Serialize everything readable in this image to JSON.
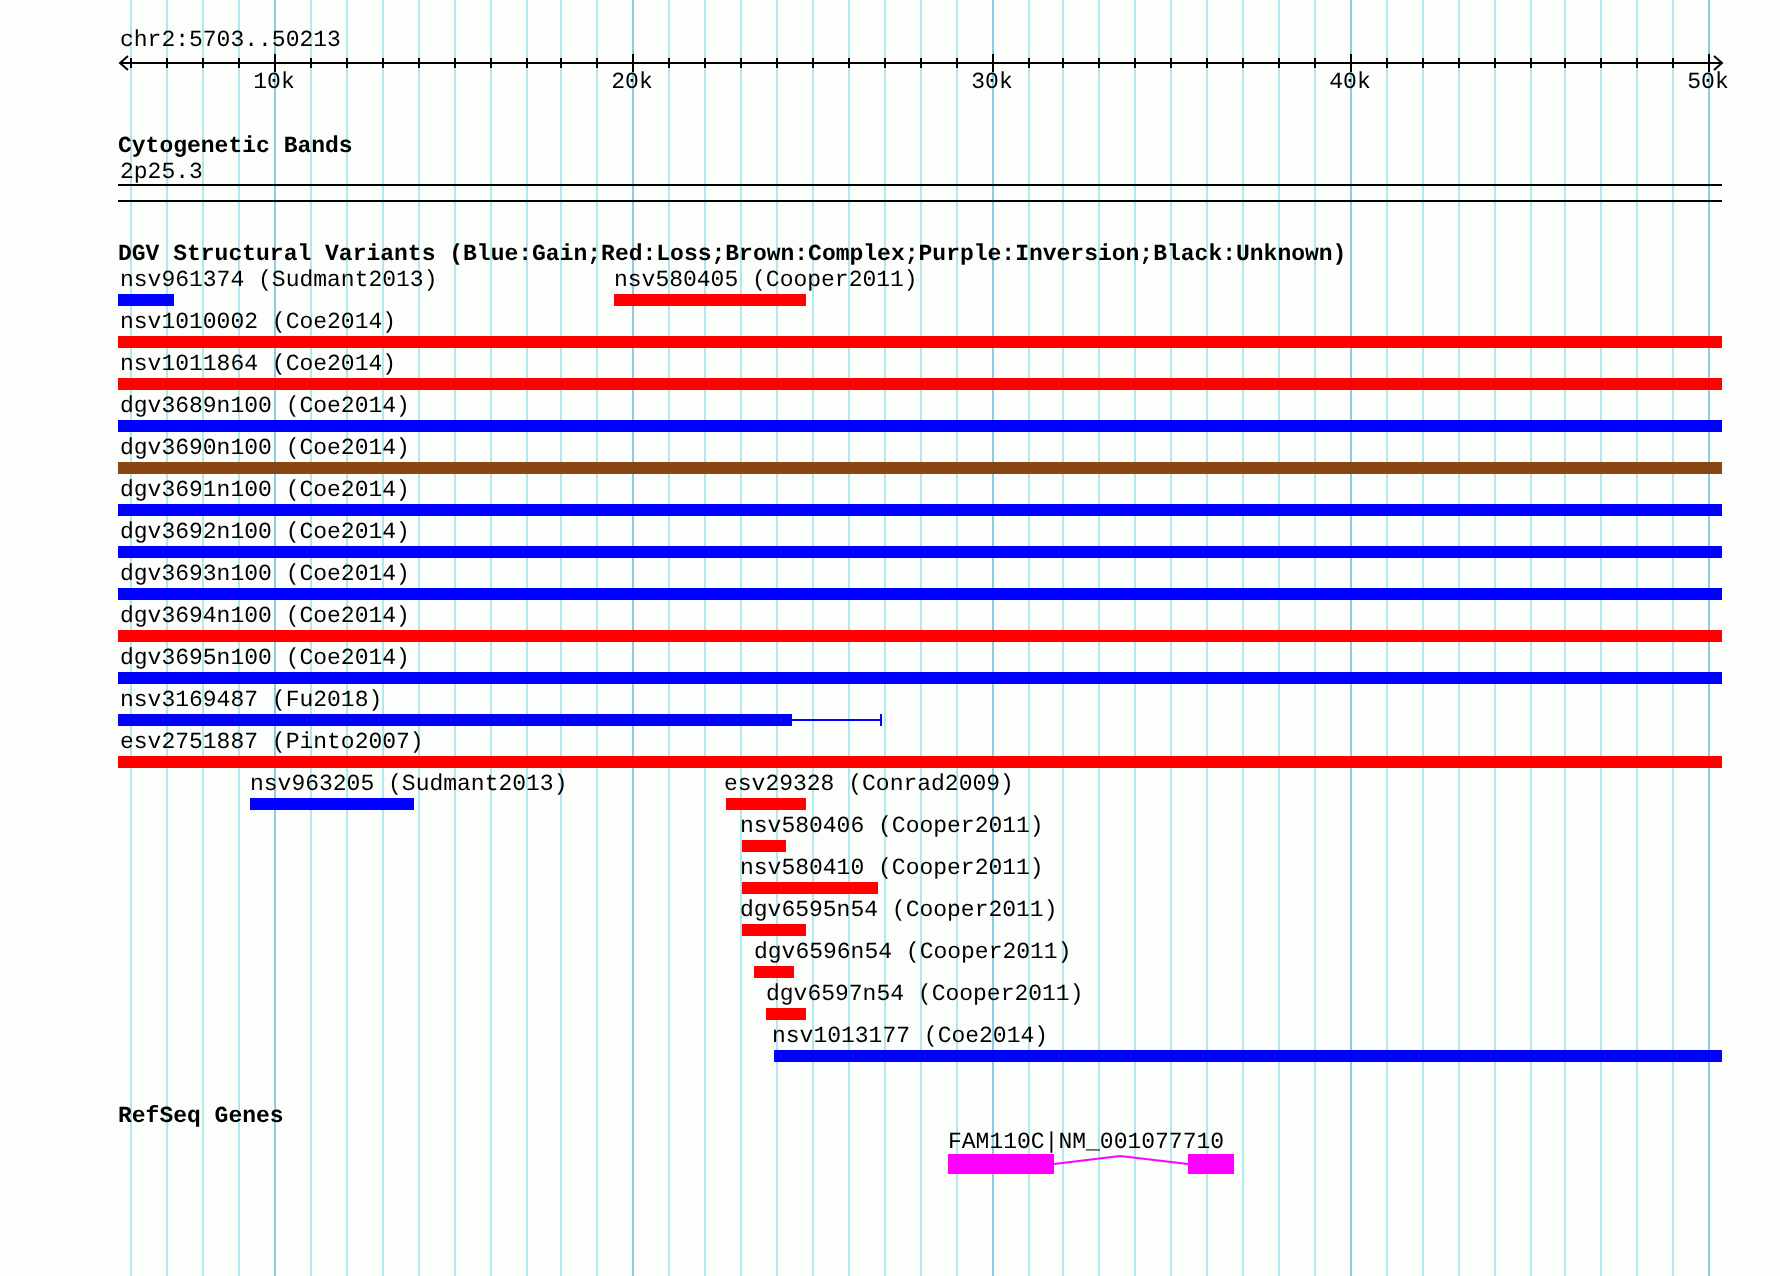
{
  "ruler": {
    "location": "chr2:5703..50213",
    "ticks": [
      "10k",
      "20k",
      "30k",
      "40k",
      "50k"
    ]
  },
  "tracks": [
    {
      "kind": "bands",
      "title": "Cytogenetic Bands",
      "features": [
        {
          "label": "2p25.3"
        }
      ]
    },
    {
      "kind": "variants",
      "title": "DGV Structural Variants (Blue:Gain;Red:Loss;Brown:Complex;Purple:Inversion;Black:Unknown)",
      "features": [
        {
          "label": "nsv961374 (Sudmant2013)",
          "color": "#0000ff"
        },
        {
          "label": "nsv580405 (Cooper2011)",
          "color": "#ff0000"
        },
        {
          "label": "nsv1010002 (Coe2014)",
          "color": "#ff0000"
        },
        {
          "label": "nsv1011864 (Coe2014)",
          "color": "#ff0000"
        },
        {
          "label": "dgv3689n100 (Coe2014)",
          "color": "#0000ff"
        },
        {
          "label": "dgv3690n100 (Coe2014)",
          "color": "#8b4513"
        },
        {
          "label": "dgv3691n100 (Coe2014)",
          "color": "#0000ff"
        },
        {
          "label": "dgv3692n100 (Coe2014)",
          "color": "#0000ff"
        },
        {
          "label": "dgv3693n100 (Coe2014)",
          "color": "#0000ff"
        },
        {
          "label": "dgv3694n100 (Coe2014)",
          "color": "#ff0000"
        },
        {
          "label": "dgv3695n100 (Coe2014)",
          "color": "#0000ff"
        },
        {
          "label": "nsv3169487 (Fu2018)",
          "color": "#0000ff"
        },
        {
          "label": "esv2751887 (Pinto2007)",
          "color": "#ff0000"
        },
        {
          "label": "nsv963205 (Sudmant2013)",
          "color": "#0000ff"
        },
        {
          "label": "esv29328 (Conrad2009)",
          "color": "#ff0000"
        },
        {
          "label": "nsv580406 (Cooper2011)",
          "color": "#ff0000"
        },
        {
          "label": "nsv580410 (Cooper2011)",
          "color": "#ff0000"
        },
        {
          "label": "dgv6595n54 (Cooper2011)",
          "color": "#ff0000"
        },
        {
          "label": "dgv6596n54 (Cooper2011)",
          "color": "#ff0000"
        },
        {
          "label": "dgv6597n54 (Cooper2011)",
          "color": "#ff0000"
        },
        {
          "label": "nsv1013177 (Coe2014)",
          "color": "#0000ff"
        }
      ]
    },
    {
      "kind": "genes",
      "title": "RefSeq Genes",
      "features": [
        {
          "label": "FAM110C|NM_001077710",
          "color": "#ff00ff"
        }
      ]
    }
  ]
}
